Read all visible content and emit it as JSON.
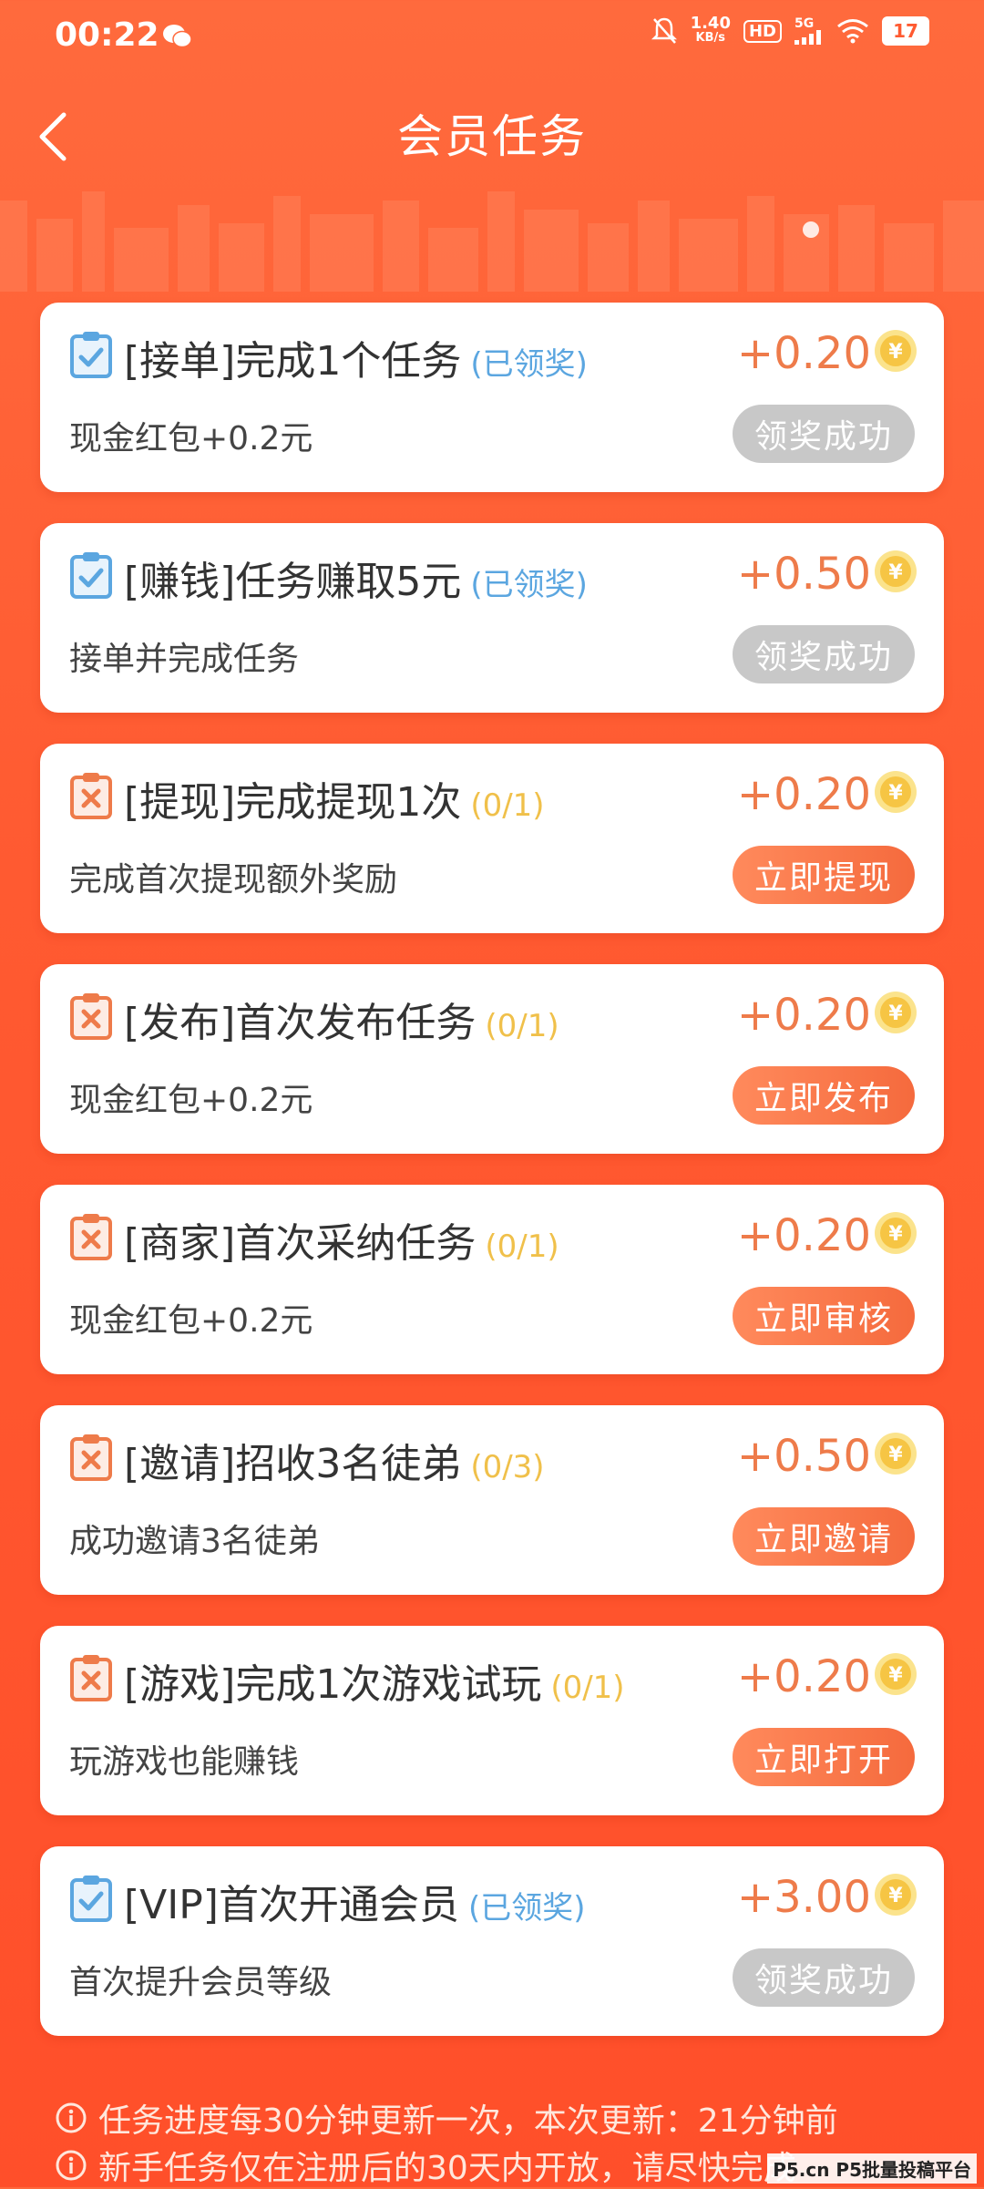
{
  "status_bar": {
    "time": "00:22",
    "speed_value": "1.40",
    "speed_unit": "KB/s",
    "hd": "HD",
    "network": "5G",
    "battery": "17"
  },
  "header": {
    "title": "会员任务"
  },
  "tasks": [
    {
      "title": "[接单]完成1个任务",
      "status": "(已领奖)",
      "reward": "+0.20",
      "desc": "现金红包+0.2元",
      "button": "领奖成功"
    },
    {
      "title": "[赚钱]任务赚取5元",
      "status": "(已领奖)",
      "reward": "+0.50",
      "desc": "接单并完成任务",
      "button": "领奖成功"
    },
    {
      "title": "[提现]完成提现1次",
      "status": "(0/1)",
      "reward": "+0.20",
      "desc": "完成首次提现额外奖励",
      "button": "立即提现"
    },
    {
      "title": "[发布]首次发布任务",
      "status": "(0/1)",
      "reward": "+0.20",
      "desc": "现金红包+0.2元",
      "button": "立即发布"
    },
    {
      "title": "[商家]首次采纳任务",
      "status": "(0/1)",
      "reward": "+0.20",
      "desc": "现金红包+0.2元",
      "button": "立即审核"
    },
    {
      "title": "[邀请]招收3名徒弟",
      "status": "(0/3)",
      "reward": "+0.50",
      "desc": "成功邀请3名徒弟",
      "button": "立即邀请"
    },
    {
      "title": "[游戏]完成1次游戏试玩",
      "status": "(0/1)",
      "reward": "+0.20",
      "desc": "玩游戏也能赚钱",
      "button": "立即打开"
    },
    {
      "title": "[VIP]首次开通会员",
      "status": "(已领奖)",
      "reward": "+3.00",
      "desc": "首次提升会员等级",
      "button": "领奖成功"
    }
  ],
  "notes": {
    "update": "任务进度每30分钟更新一次，本次更新：21分钟前",
    "newbie": "新手任务仅在注册后的30天内开放，请尽快完成"
  },
  "watermark": "P5.cn P5批量投稿平台",
  "colors": {
    "background": "#ff5a31",
    "claimed": "#5ba6e0",
    "progress": "#f0c04a",
    "reward": "#ee7b4a",
    "button_active": "#f56a3d",
    "button_done": "#c8c8c8"
  }
}
